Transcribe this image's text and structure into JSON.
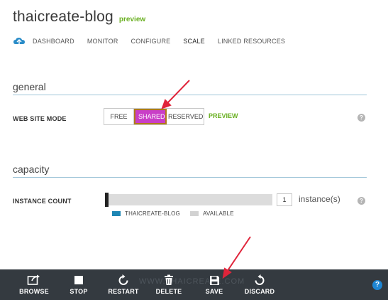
{
  "header": {
    "site_name": "thaicreate-blog",
    "preview_tag": "preview"
  },
  "nav": {
    "items": [
      {
        "label": "DASHBOARD"
      },
      {
        "label": "MONITOR"
      },
      {
        "label": "CONFIGURE"
      },
      {
        "label": "SCALE",
        "active": true
      },
      {
        "label": "LINKED RESOURCES"
      }
    ]
  },
  "general": {
    "title": "general",
    "web_site_mode_label": "WEB SITE MODE",
    "modes": [
      "FREE",
      "SHARED",
      "RESERVED"
    ],
    "selected_mode": "SHARED",
    "preview_label": "PREVIEW"
  },
  "capacity": {
    "title": "capacity",
    "instance_count_label": "INSTANCE COUNT",
    "instance_count": "1",
    "unit": "instance(s)",
    "legend": [
      "THAICREATE-BLOG",
      "AVAILABLE"
    ]
  },
  "help_glyph": "?",
  "commands": {
    "browse": "BROWSE",
    "stop": "STOP",
    "restart": "RESTART",
    "delete": "DELETE",
    "save": "SAVE",
    "discard": "DISCARD",
    "watermark": "WWW.THAICREATE.COM"
  },
  "colors": {
    "accent_shared": "#c93ec7",
    "preview_green": "#6ab022",
    "command_bar": "#343a40",
    "blog_series": "#1e86b4",
    "annotation_arrow": "#e0243a"
  }
}
